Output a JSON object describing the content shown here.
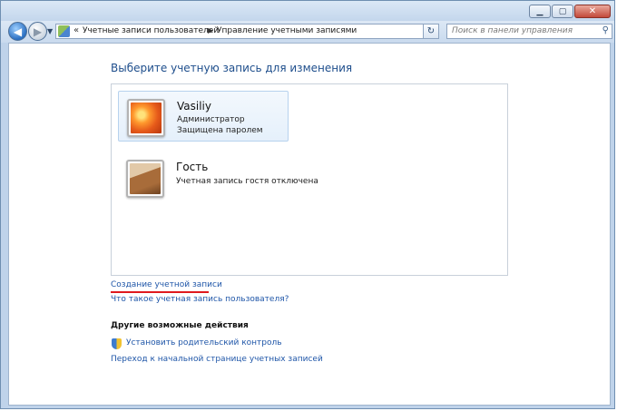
{
  "titlebar": {
    "minimize_icon": "minimize-icon",
    "maximize_icon": "maximize-icon",
    "close_icon": "close-icon"
  },
  "navbar": {
    "back_icon": "back-arrow-icon",
    "forward_icon": "forward-arrow-icon",
    "breadcrumb_prefix": "«",
    "breadcrumbs": [
      "Учетные записи пользователей",
      "Управление учетными записями"
    ],
    "search_placeholder": "Поиск в панели управления"
  },
  "main": {
    "heading": "Выберите учетную запись для изменения",
    "accounts": [
      {
        "name": "Vasiliy",
        "lines": [
          "Администратор",
          "Защищена паролем"
        ],
        "avatar": "flower-avatar",
        "selected": true
      },
      {
        "name": "Гость",
        "lines": [
          "Учетная запись гостя отключена"
        ],
        "avatar": "guest-briefcase-avatar",
        "selected": false
      }
    ],
    "create_account_link": "Создание учетной записи",
    "what_is_link": "Что такое учетная запись пользователя?",
    "other_actions_title": "Другие возможные действия",
    "parental_control_link": "Установить родительский контроль",
    "go_to_main_link": "Переход к начальной странице учетных записей"
  },
  "colors": {
    "link": "#1f56a8",
    "heading": "#1e4e8c",
    "highlight_underline": "#e0191d"
  }
}
